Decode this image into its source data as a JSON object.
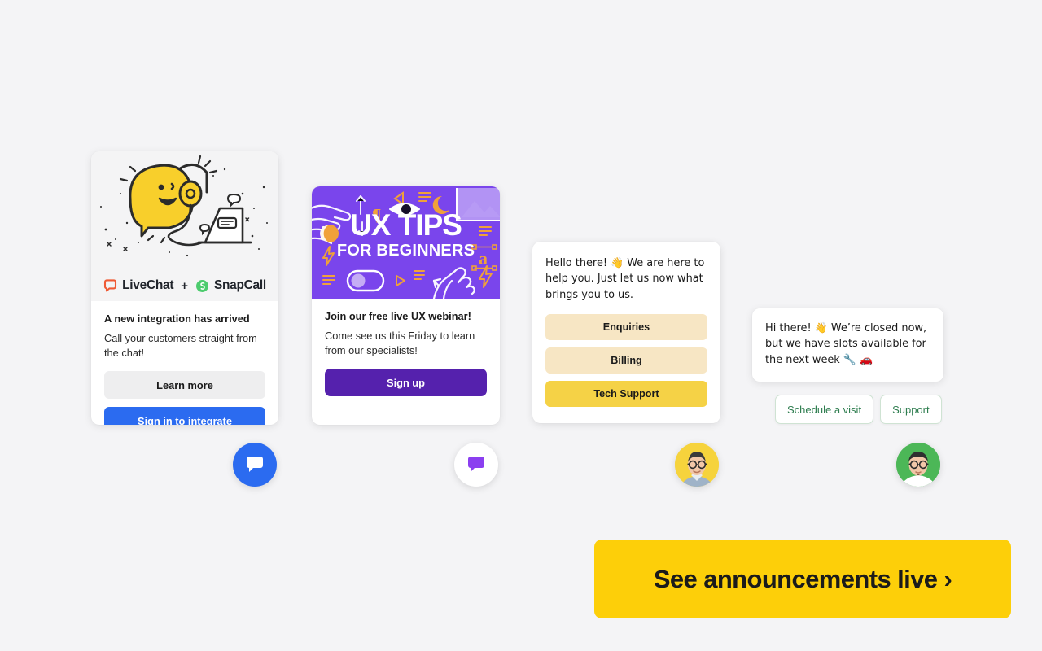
{
  "page": {
    "background_color": "#f4f4f6"
  },
  "cards": {
    "integration": {
      "illustration_name": "livechat-mascot-on-laptop-illustration",
      "brand_left": "LiveChat",
      "brand_separator": "+",
      "brand_right": "SnapCall",
      "title": "A new integration has arrived",
      "subtitle": "Call your customers straight from the chat!",
      "secondary_button": "Learn more",
      "primary_button": "Sign in to integrate",
      "primary_color": "#2b6bf0",
      "livechat_icon_color": "#ef5a35",
      "snapcall_icon_color": "#4ccb6d"
    },
    "ux_tips": {
      "banner_heading": "UX TIPS",
      "banner_subheading": "FOR BEGINNERS",
      "banner_color": "#7a45ec",
      "title": "Join our free live UX webinar!",
      "subtitle": "Come see us this Friday to learn from our specialists!",
      "primary_button": "Sign up",
      "primary_color": "#5521ad"
    },
    "greeting": {
      "message": "Hello there! 👋 We are here to help you. Just let us now what brings you to us.",
      "choices": [
        {
          "label": "Enquiries",
          "color": "#f7e6c4",
          "highlighted": false
        },
        {
          "label": "Billing",
          "color": "#f7e6c4",
          "highlighted": false
        },
        {
          "label": "Tech Support",
          "color": "#f5d246",
          "highlighted": true
        }
      ]
    },
    "closed_now": {
      "message": "Hi there! 👋 We’re closed now, but we have slots available for the next week 🔧 🚗",
      "quick_replies": [
        {
          "label": "Schedule a visit"
        },
        {
          "label": "Support"
        }
      ],
      "quick_reply_color": "#2e7d4f"
    }
  },
  "launchers": [
    {
      "name": "chat-bubble-blue",
      "style": "bubble",
      "background": "#2b6bf0",
      "glyph_color": "#ffffff"
    },
    {
      "name": "chat-bubble-white",
      "style": "bubble",
      "background": "#ffffff",
      "glyph_color": "#8b3ff0"
    },
    {
      "name": "avatar-yellow",
      "style": "avatar",
      "background": "#f6d33c"
    },
    {
      "name": "avatar-green",
      "style": "avatar",
      "background": "#4cb757"
    }
  ],
  "cta": {
    "label": "See announcements live ›",
    "background": "#fdcf09",
    "text_color": "#1b1b1b"
  }
}
